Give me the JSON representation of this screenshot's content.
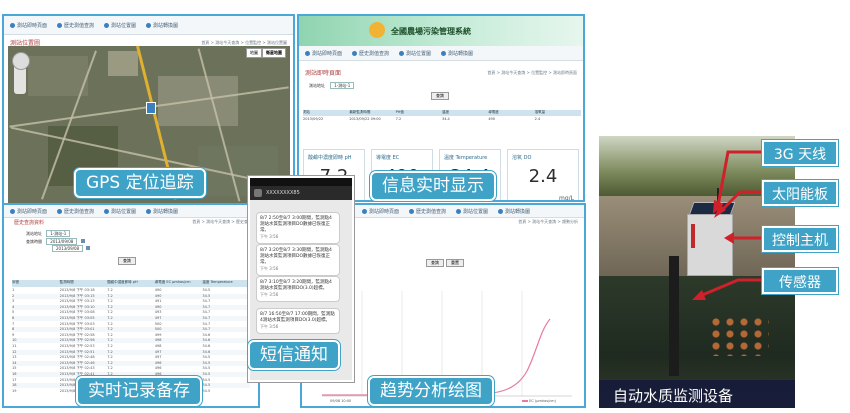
{
  "nav_items": [
    "測站即時頁面",
    "歷史測值查詢",
    "測站位置圖",
    "測站轉換圖"
  ],
  "gps": {
    "page_title": "測站位置圖",
    "crumb": "首頁 > 測站今天查詢 > 位置監控 > 測站位置圖",
    "map_buttons": [
      "地圖",
      "衛星地圖"
    ],
    "caption": "GPS 定位追踪"
  },
  "info": {
    "header_title": "全國農場污染管理系統",
    "page_title": "測站即時頁面",
    "crumb": "首頁 > 測站今天查詢 > 位置監控 > 測站即時頁面",
    "filter_label": "測站地址",
    "filter_value": "1-測站-1",
    "query_button": "查詢",
    "table_headers": [
      "測站",
      "最新監測時間",
      "PH值",
      "溫度",
      "導電度",
      "溶氧量"
    ],
    "table_row": [
      "2013/09/22",
      "2013/09/22 09:00",
      "7.2",
      "34.4",
      "490",
      "2.4"
    ],
    "metrics": [
      {
        "label": "酸鹼中濃度即時 pH",
        "value": "7.2",
        "unit": ""
      },
      {
        "label": "導電度 EC",
        "value": "490",
        "unit": ""
      },
      {
        "label": "溫度 Temperature",
        "value": "34.4",
        "unit": ""
      },
      {
        "label": "溶氧 DO",
        "value": "2.4",
        "unit": "mg/L"
      }
    ],
    "caption": "信息实时显示"
  },
  "record": {
    "page_title": "歷史查詢資料",
    "crumb": "首頁 > 測站今天查詢 > 歷史查詢",
    "field1_label": "測站地址",
    "field1_value": "1-測站-1",
    "field2_label": "查詢時間",
    "date_from": "2013/09/08",
    "date_to": "2013/09/08",
    "query_button": "查詢",
    "table_headers": [
      "序號",
      "監測時間",
      "酸鹼中濃度即時 pH",
      "導電度 EC μmhos/cm",
      "溫度 Temperature"
    ],
    "rows": [
      [
        "1",
        "2013/9/8 下午 03:18",
        "7.2",
        "490",
        "34.5"
      ],
      [
        "2",
        "2013/9/8 下午 03:15",
        "7.2",
        "490",
        "34.5"
      ],
      [
        "3",
        "2013/9/8 下午 03:13",
        "7.2",
        "491",
        "34.7"
      ],
      [
        "4",
        "2013/9/8 下午 03:10",
        "7.2",
        "490",
        "34.7"
      ],
      [
        "5",
        "2013/9/8 下午 03:08",
        "7.2",
        "493",
        "34.7"
      ],
      [
        "6",
        "2013/9/8 下午 03:05",
        "7.2",
        "497",
        "34.7"
      ],
      [
        "7",
        "2013/9/8 下午 03:03",
        "7.2",
        "500",
        "34.7"
      ],
      [
        "8",
        "2013/9/8 下午 03:01",
        "7.2",
        "500",
        "34.7"
      ],
      [
        "9",
        "2013/9/8 下午 02:58",
        "7.2",
        "499",
        "34.6"
      ],
      [
        "10",
        "2013/9/8 下午 02:56",
        "7.2",
        "498",
        "34.6"
      ],
      [
        "11",
        "2013/9/8 下午 02:53",
        "7.2",
        "498",
        "34.6"
      ],
      [
        "12",
        "2013/9/8 下午 02:51",
        "7.2",
        "497",
        "34.6"
      ],
      [
        "13",
        "2013/9/8 下午 02:48",
        "7.2",
        "497",
        "34.5"
      ],
      [
        "14",
        "2013/9/8 下午 02:46",
        "7.2",
        "496",
        "34.5"
      ],
      [
        "15",
        "2013/9/8 下午 02:43",
        "7.2",
        "496",
        "34.5"
      ],
      [
        "16",
        "2013/9/8 下午 02:41",
        "7.2",
        "496",
        "34.5"
      ],
      [
        "17",
        "2013/9/8 下午 02:38",
        "7.2",
        "495",
        "34.5"
      ],
      [
        "18",
        "2013/9/8 下午 02:36",
        "7.2",
        "495",
        "34.5"
      ],
      [
        "19",
        "2013/9/8 下午 02:33",
        "7.2",
        "495",
        "34.5"
      ]
    ],
    "caption": "实时记录备存"
  },
  "sms": {
    "sender": "XXXXXXXX85",
    "messages": [
      {
        "text": "8/7 2:50至8/7 3:00期間，監測點4測站水質監測項目DO數據已恢復正常。",
        "time": "下午 3:56"
      },
      {
        "text": "8/7 3:20至8/7 3:30期間，監測點4測站水質監測項目DO數據已恢復正常。",
        "time": "下午 3:56"
      },
      {
        "text": "8/7 3:10至8/7 3:20期間，監測點4測站水質監測項目DO(3.0)超標。",
        "time": "下午 3:56"
      },
      {
        "text": "8/7 16:50至8/7 17:00期間，監測點4測站水質監測項目DO(3.0)超標。",
        "time": "下午 3:56"
      }
    ],
    "caption": "短信通知"
  },
  "trend": {
    "crumb": "首頁 > 測站今天查詢 > 趨勢分析",
    "query_button": "查詢",
    "reset_button": "重置",
    "x_labels": [
      "09/08 10:00",
      "09/08 12:00"
    ],
    "legend": "EC (μmhos/cm)",
    "caption": "趋势分析绘图"
  },
  "device": {
    "callouts": [
      "3G 天线",
      "太阳能板",
      "控制主机",
      "传感器"
    ],
    "caption": "自动水质监测设备"
  },
  "colors": {
    "accent": "#3fa3c7",
    "arrow": "#d0202a",
    "curve": "#e87aa0"
  }
}
